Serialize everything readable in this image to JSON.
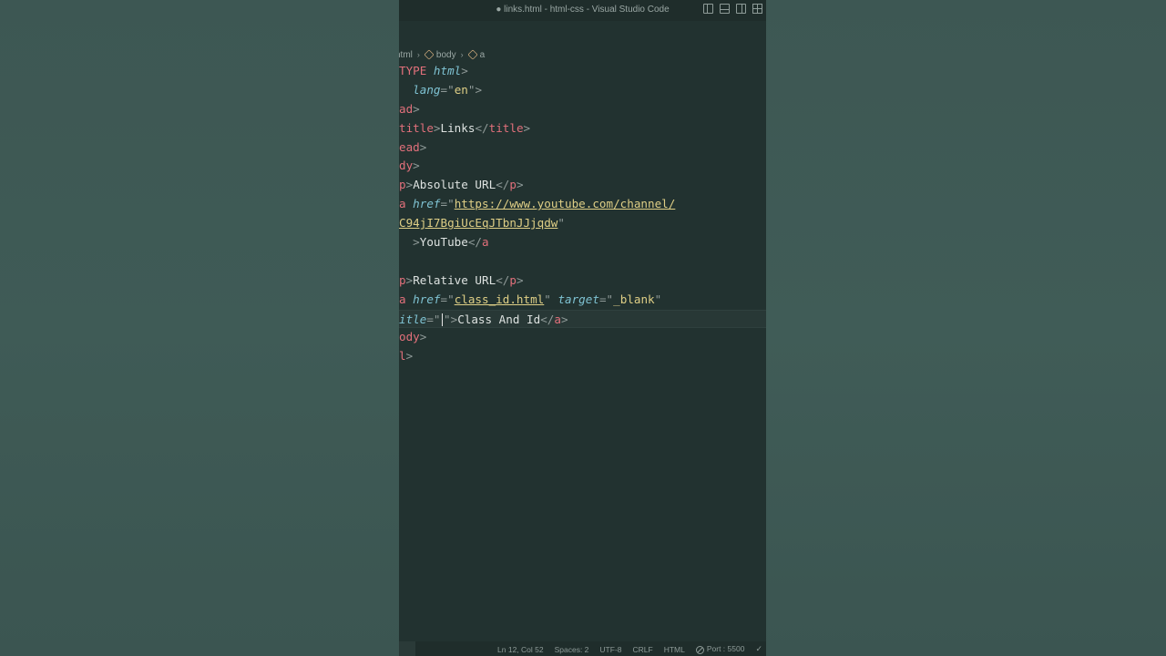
{
  "window": {
    "title": "● links.html - html-css - Visual Studio Code"
  },
  "breadcrumb": {
    "items": [
      "html",
      "body",
      "a"
    ]
  },
  "editor": {
    "lines": [
      [
        [
          "t",
          "TYPE "
        ],
        [
          "a",
          "html"
        ],
        [
          "p",
          ">"
        ]
      ],
      [
        [
          "p",
          "  "
        ],
        [
          "a",
          "lang"
        ],
        [
          "p",
          "=\""
        ],
        [
          "s",
          "en"
        ],
        [
          "p",
          "\">"
        ]
      ],
      [
        [
          "t",
          "ad"
        ],
        [
          "p",
          ">"
        ]
      ],
      [
        [
          "t",
          "title"
        ],
        [
          "p",
          ">"
        ],
        [
          "txt",
          "Links"
        ],
        [
          "p",
          "</"
        ],
        [
          "t",
          "title"
        ],
        [
          "p",
          ">"
        ]
      ],
      [
        [
          "t",
          "ead"
        ],
        [
          "p",
          ">"
        ]
      ],
      [
        [
          "t",
          "dy"
        ],
        [
          "p",
          ">"
        ]
      ],
      [
        [
          "t",
          "p"
        ],
        [
          "p",
          ">"
        ],
        [
          "txt",
          "Absolute URL"
        ],
        [
          "p",
          "</"
        ],
        [
          "t",
          "p"
        ],
        [
          "p",
          ">"
        ]
      ],
      [
        [
          "t",
          "a "
        ],
        [
          "a",
          "href"
        ],
        [
          "p",
          "=\""
        ],
        [
          "su",
          "https://www.youtube.com/channel/"
        ]
      ],
      [
        [
          "su",
          "C94jI7BgiUcEqJTbnJJjqdw"
        ],
        [
          "p",
          "\""
        ]
      ],
      [
        [
          "p",
          "  >"
        ],
        [
          "txt",
          "YouTube"
        ],
        [
          "p",
          "</"
        ],
        [
          "t",
          "a"
        ]
      ],
      [],
      [
        [
          "t",
          "p"
        ],
        [
          "p",
          ">"
        ],
        [
          "txt",
          "Relative URL"
        ],
        [
          "p",
          "</"
        ],
        [
          "t",
          "p"
        ],
        [
          "p",
          ">"
        ]
      ],
      [
        [
          "t",
          "a "
        ],
        [
          "a",
          "href"
        ],
        [
          "p",
          "=\""
        ],
        [
          "su",
          "class_id.html"
        ],
        [
          "p",
          "\" "
        ],
        [
          "a",
          "target"
        ],
        [
          "p",
          "=\""
        ],
        [
          "s",
          "_blank"
        ],
        [
          "p",
          "\""
        ]
      ],
      [
        [
          "a",
          "itle"
        ],
        [
          "p",
          "=\""
        ],
        [
          "cursor",
          ""
        ],
        [
          "p",
          "\">"
        ],
        [
          "txt",
          "Class And Id"
        ],
        [
          "p",
          "</"
        ],
        [
          "t",
          "a"
        ],
        [
          "p",
          ">"
        ]
      ],
      [
        [
          "t",
          "ody"
        ],
        [
          "p",
          ">"
        ]
      ],
      [
        [
          "t",
          "l"
        ],
        [
          "p",
          ">"
        ]
      ]
    ],
    "current_line": 13
  },
  "status": {
    "position": "Ln 12, Col 52",
    "spaces": "Spaces: 2",
    "encoding": "UTF-8",
    "eol": "CRLF",
    "language": "HTML",
    "port": "Port : 5500"
  }
}
